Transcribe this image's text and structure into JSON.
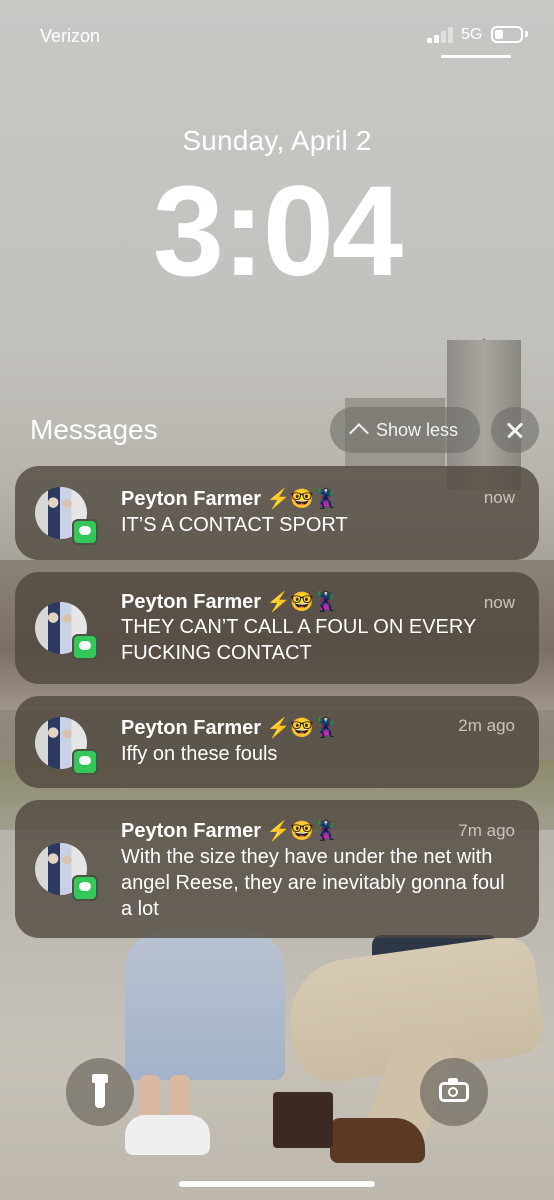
{
  "status_bar": {
    "carrier": "Verizon",
    "network": "5G",
    "battery_level": 0.35
  },
  "lock": {
    "date": "Sunday, April 2",
    "time": "3:04"
  },
  "group": {
    "title": "Messages",
    "show_less_label": "Show less",
    "close_icon": "close-icon"
  },
  "notifications": [
    {
      "sender": "Peyton Farmer",
      "emoji": "⚡🤓🦹",
      "time": "now",
      "body": "IT’S A CONTACT SPORT"
    },
    {
      "sender": "Peyton Farmer",
      "emoji": "⚡🤓🦹",
      "time": "now",
      "body": "THEY CAN’T CALL A FOUL ON EVERY FUCKING CONTACT"
    },
    {
      "sender": "Peyton Farmer",
      "emoji": "⚡🤓🦹",
      "time": "2m ago",
      "body": "Iffy on these fouls"
    },
    {
      "sender": "Peyton Farmer",
      "emoji": "⚡🤓🦹",
      "time": "7m ago",
      "body": "With the size they have under the net with angel Reese, they are inevitably gonna foul a lot"
    }
  ],
  "quick_actions": {
    "left_icon": "flashlight-icon",
    "right_icon": "camera-icon"
  },
  "colors": {
    "app_badge": "#34c759",
    "card": "#4e463e"
  }
}
